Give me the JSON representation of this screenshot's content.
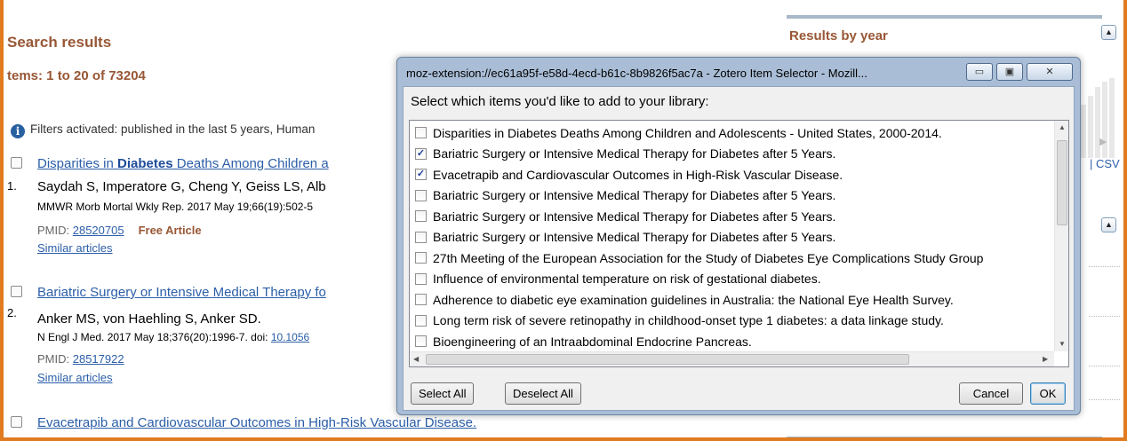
{
  "background_page": {
    "search_results_title": "Search results",
    "items_count": "tems: 1 to 20 of 73204",
    "filters_text": "Filters activated: published in the last 5 years, Human",
    "results": [
      {
        "num": "1.",
        "title_pre": "Disparities in ",
        "title_bold": "Diabetes",
        "title_post": " Deaths Among Children a",
        "authors": "Saydah S, Imperatore G, Cheng Y, Geiss LS, Alb",
        "journal": "MMWR Morb Mortal Wkly Rep. 2017 May 19;66(19):502-5",
        "journal_link": "",
        "pmid_label": "PMID: ",
        "pmid": "28520705",
        "free_article": "Free Article",
        "similar": "Similar articles"
      },
      {
        "num": "2.",
        "title_pre": "Bariatric Surgery or Intensive Medical Therapy fo",
        "title_bold": "",
        "title_post": "",
        "authors": "Anker MS, von Haehling S, Anker SD.",
        "journal": "N Engl J Med. 2017 May 18;376(20):1996-7. doi: ",
        "journal_link": "10.1056",
        "pmid_label": "PMID: ",
        "pmid": "28517922",
        "free_article": "",
        "similar": "Similar articles"
      },
      {
        "num": "",
        "title_pre": "Evacetrapib and Cardiovascular Outcomes in High-Risk Vascular Disease.",
        "title_bold": "",
        "title_post": "",
        "authors": "",
        "journal": "",
        "journal_link": "",
        "pmid_label": "",
        "pmid": "",
        "free_article": "",
        "similar": ""
      }
    ],
    "results_by_year_title": "Results by year",
    "csv_label": "CSV"
  },
  "dialog": {
    "title": "moz-extension://ec61a95f-e58d-4ecd-b61c-8b9826f5ac7a - Zotero Item Selector - Mozill...",
    "prompt": "Select which items you'd like to add to your library:",
    "items": [
      {
        "label": "Disparities in Diabetes Deaths Among Children and Adolescents - United States, 2000-2014.",
        "checked": false
      },
      {
        "label": "Bariatric Surgery or Intensive Medical Therapy for Diabetes after 5 Years.",
        "checked": true
      },
      {
        "label": "Evacetrapib and Cardiovascular Outcomes in High-Risk Vascular Disease.",
        "checked": true
      },
      {
        "label": "Bariatric Surgery or Intensive Medical Therapy for Diabetes after 5 Years.",
        "checked": false
      },
      {
        "label": "Bariatric Surgery or Intensive Medical Therapy for Diabetes after 5 Years.",
        "checked": false
      },
      {
        "label": "Bariatric Surgery or Intensive Medical Therapy for Diabetes after 5 Years.",
        "checked": false
      },
      {
        "label": "27th Meeting of the European Association for the Study of Diabetes Eye Complications Study Group",
        "checked": false
      },
      {
        "label": "Influence of environmental temperature on risk of gestational diabetes.",
        "checked": false
      },
      {
        "label": "Adherence to diabetic eye examination guidelines in Australia: the National Eye Health Survey.",
        "checked": false
      },
      {
        "label": "Long term risk of severe retinopathy in childhood-onset type 1 diabetes: a data linkage study.",
        "checked": false
      },
      {
        "label": "Bioengineering of an Intraabdominal Endocrine Pancreas.",
        "checked": false
      }
    ],
    "select_all": "Select All",
    "deselect_all": "Deselect All",
    "cancel": "Cancel",
    "ok": "OK"
  }
}
